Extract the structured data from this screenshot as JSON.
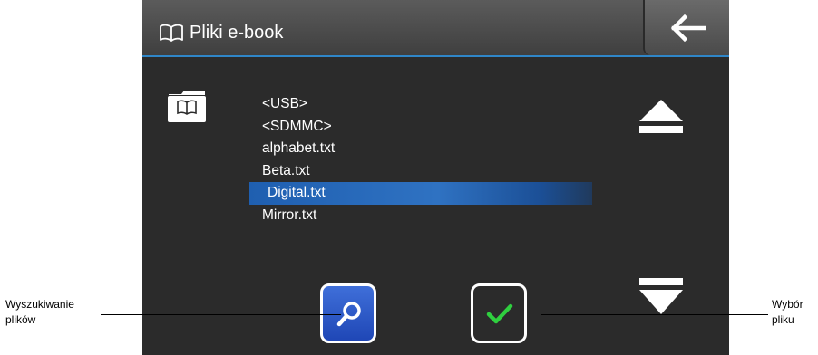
{
  "title_bar": {
    "title": "Pliki e-book",
    "title_icon": "book-icon",
    "back_icon": "arrow-left-icon"
  },
  "folder_icon": "folder-book-icon",
  "files": [
    {
      "name": "<USB>",
      "selected": false
    },
    {
      "name": "<SDMMC>",
      "selected": false
    },
    {
      "name": "alphabet.txt",
      "selected": false
    },
    {
      "name": "Beta.txt",
      "selected": false
    },
    {
      "name": "Digital.txt",
      "selected": true
    },
    {
      "name": "Mirror.txt",
      "selected": false
    }
  ],
  "buttons": {
    "scroll_up_icon": "eject-up-icon",
    "scroll_down_icon": "eject-down-icon",
    "search_icon": "magnifier-icon",
    "select_icon": "checkmark-icon"
  },
  "callouts": {
    "left_line1": "Wyszukiwanie",
    "left_line2": "plików",
    "right_line1": "Wybór",
    "right_line2": "pliku"
  },
  "colors": {
    "selection": "#2f72c2",
    "search_button": "#1f47b6",
    "checkmark": "#2fcf3f",
    "title_underline": "#2f86c8"
  }
}
